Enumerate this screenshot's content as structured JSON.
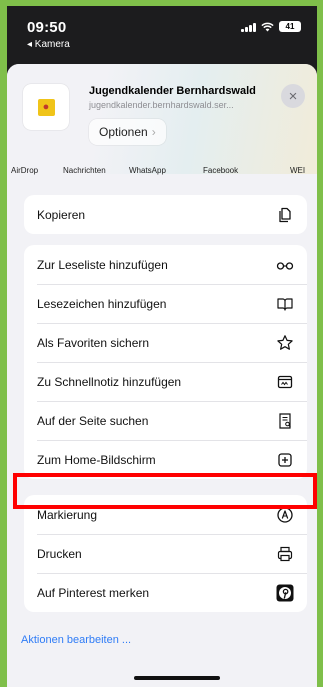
{
  "status_bar": {
    "time": "09:50",
    "back_label": "◂ Kamera",
    "battery": "41"
  },
  "header": {
    "site_title": "Jugendkalender Bernhardswald",
    "site_url": "jugendkalender.bernhardswald.ser...",
    "options_label": "Optionen",
    "close_glyph": "×"
  },
  "share_targets": [
    "AirDrop",
    "Nachrichten",
    "WhatsApp",
    "Facebook",
    "WEI"
  ],
  "groups": [
    {
      "items": [
        {
          "label": "Kopieren",
          "icon": "copy-icon"
        }
      ]
    },
    {
      "items": [
        {
          "label": "Zur Leseliste hinzufügen",
          "icon": "glasses-icon"
        },
        {
          "label": "Lesezeichen hinzufügen",
          "icon": "book-icon"
        },
        {
          "label": "Als Favoriten sichern",
          "icon": "star-icon"
        },
        {
          "label": "Zu Schnellnotiz hinzufügen",
          "icon": "quick-note-icon"
        },
        {
          "label": "Auf der Seite suchen",
          "icon": "find-on-page-icon"
        },
        {
          "label": "Zum Home-Bildschirm",
          "icon": "add-square-icon"
        }
      ]
    },
    {
      "items": [
        {
          "label": "Markierung",
          "icon": "markup-icon"
        },
        {
          "label": "Drucken",
          "icon": "printer-icon"
        },
        {
          "label": "Auf Pinterest merken",
          "icon": "pinterest-icon"
        }
      ]
    }
  ],
  "edit_actions_label": "Aktionen bearbeiten ...",
  "colors": {
    "accent": "#2f7cf6",
    "highlight": "#ff0000",
    "frame": "#7fbf4a"
  }
}
